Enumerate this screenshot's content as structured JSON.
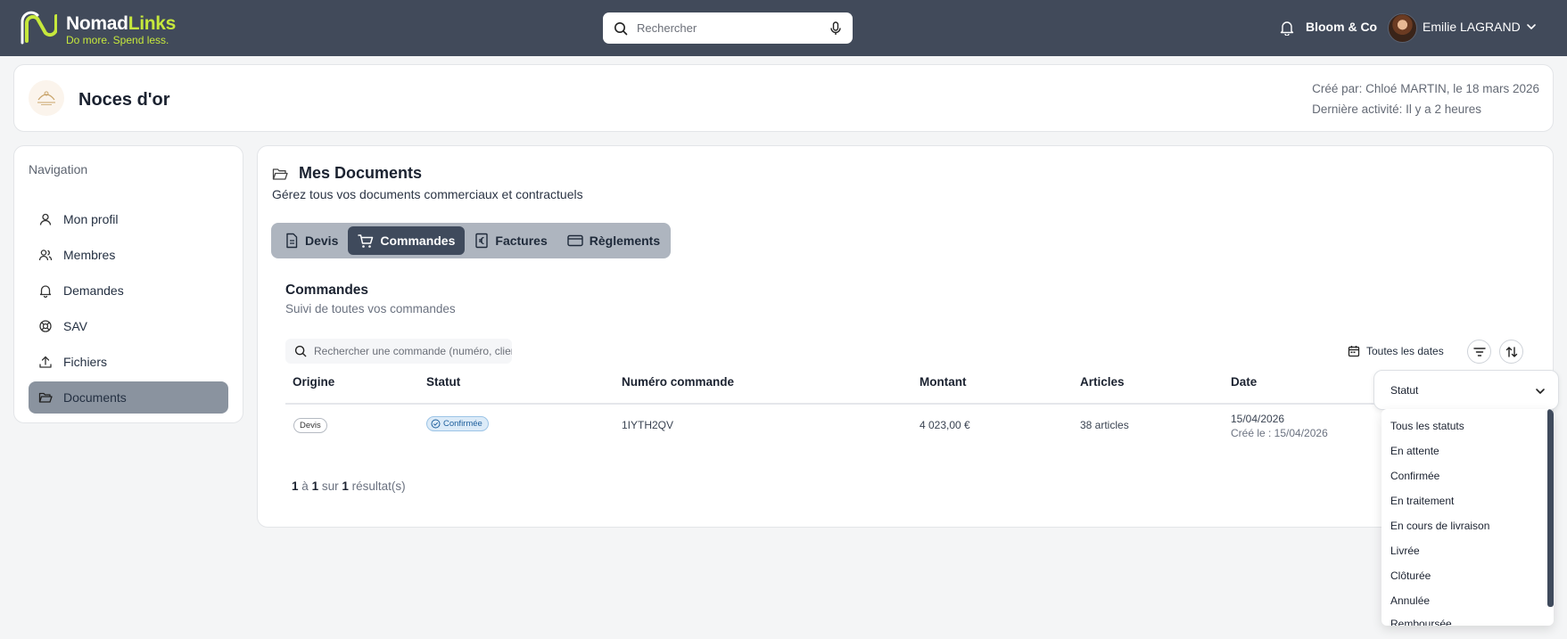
{
  "topbar": {
    "brand_part1": "Nomad",
    "brand_part2": "Links",
    "tagline": "Do more. Spend less.",
    "search_placeholder": "Rechercher",
    "company": "Bloom & Co",
    "user": "Emilie LAGRAND",
    "icons": [
      "search-icon",
      "microphone-icon",
      "bell-icon",
      "chevron-down-icon"
    ]
  },
  "project": {
    "title": "Noces d'or",
    "created_by": "Créé par: Chloé MARTIN, le 18 mars 2026",
    "last_activity": "Dernière activité: Il y a 2 heures"
  },
  "nav": {
    "title": "Navigation",
    "items": [
      {
        "label": "Mon profil",
        "icon": "user-icon"
      },
      {
        "label": "Membres",
        "icon": "users-icon"
      },
      {
        "label": "Demandes",
        "icon": "bell-icon"
      },
      {
        "label": "SAV",
        "icon": "lifebuoy-icon"
      },
      {
        "label": "Fichiers",
        "icon": "upload-icon"
      },
      {
        "label": "Documents",
        "icon": "folder-icon",
        "active": true
      }
    ]
  },
  "documents": {
    "title": "Mes Documents",
    "subtitle": "Gérez tous vos documents commerciaux et contractuels",
    "tabs": [
      {
        "label": "Devis",
        "icon": "document-icon"
      },
      {
        "label": "Commandes",
        "icon": "cart-icon",
        "active": true
      },
      {
        "label": "Factures",
        "icon": "euro-receipt-icon"
      },
      {
        "label": "Règlements",
        "icon": "credit-card-icon"
      }
    ]
  },
  "orders": {
    "title": "Commandes",
    "subtitle": "Suivi de toutes vos commandes",
    "search_placeholder": "Rechercher une commande (numéro, client...)",
    "date_filter": "Toutes les dates",
    "columns": [
      "Origine",
      "Statut",
      "Numéro commande",
      "Montant",
      "Articles",
      "Date"
    ],
    "rows": [
      {
        "origin": "Devis",
        "status": "Confirmée",
        "number": "1IYTH2QV",
        "amount": "4 023,00 €",
        "articles": "38 articles",
        "date": "15/04/2026",
        "created": "Créé le : 15/04/2026"
      }
    ],
    "pager": {
      "from": "1",
      "to_word": "à",
      "to": "1",
      "of_word": "sur",
      "total": "1",
      "suffix": "résultat(s)"
    }
  },
  "status_filter": {
    "label": "Statut",
    "options": [
      "Tous les statuts",
      "En attente",
      "Confirmée",
      "En traitement",
      "En cours de livraison",
      "Livrée",
      "Clôturée",
      "Annulée",
      "Remboursée"
    ]
  },
  "colors": {
    "topbar": "#414a5a",
    "accent": "#c6e83c",
    "active_tab": "#3f4a5c",
    "active_nav": "#8a939f",
    "status_badge": "#dcebf8"
  }
}
